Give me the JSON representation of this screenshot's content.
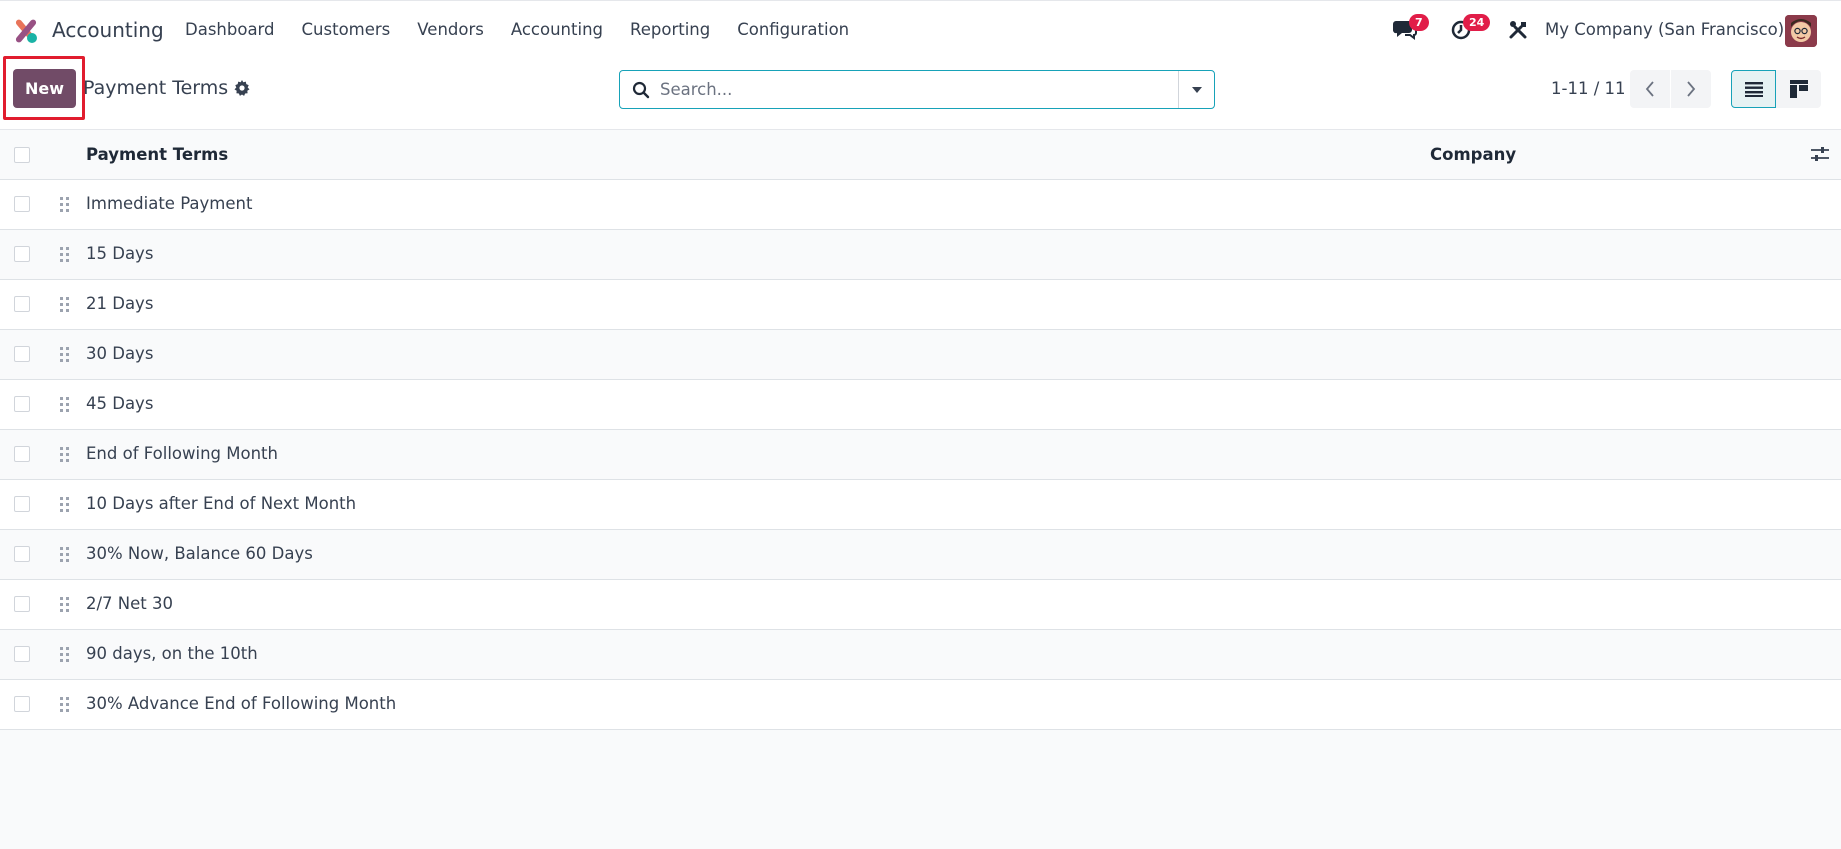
{
  "app": {
    "name": "Accounting"
  },
  "nav": {
    "menu": [
      "Dashboard",
      "Customers",
      "Vendors",
      "Accounting",
      "Reporting",
      "Configuration"
    ],
    "messages_count": "7",
    "activities_count": "24",
    "company": "My Company (San Francisco)"
  },
  "control": {
    "new_label": "New",
    "breadcrumb": "Payment Terms",
    "search_placeholder": "Search...",
    "pager": "1-11 / 11"
  },
  "table": {
    "columns": [
      "Payment Terms",
      "Company"
    ],
    "rows": [
      "Immediate Payment",
      "15 Days",
      "21 Days",
      "30 Days",
      "45 Days",
      "End of Following Month",
      "10 Days after End of Next Month",
      "30% Now, Balance 60 Days",
      "2/7 Net 30",
      "90 days, on the 10th",
      "30% Advance End of Following Month"
    ]
  },
  "colors": {
    "primary": "#714b67",
    "accent": "#17a2b8",
    "badge": "#e11d48",
    "highlight": "#e11d2e"
  }
}
